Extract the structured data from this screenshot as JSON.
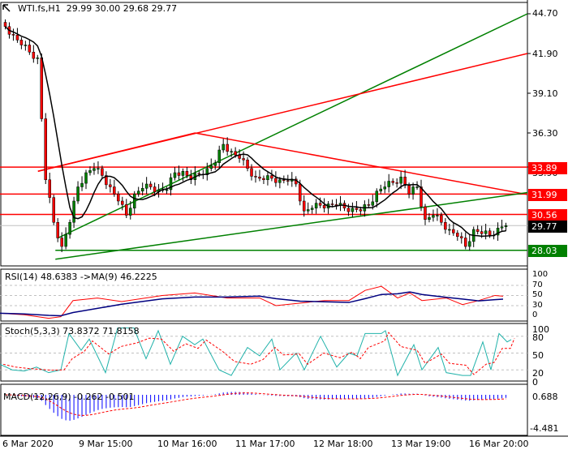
{
  "header": {
    "symbol": "WTI.fs,H1",
    "ohlc": "29.99 30.00 29.68 29.77"
  },
  "price_axis": [
    "44.70",
    "41.90",
    "39.10",
    "36.30",
    "33.90"
  ],
  "price_tags": [
    {
      "label": "33.89",
      "color": "#ff0000"
    },
    {
      "label": "31.99",
      "color": "#ff0000"
    },
    {
      "label": "30.56",
      "color": "#ff0000"
    },
    {
      "label": "29.77",
      "color": "#000000"
    },
    {
      "label": "28.03",
      "color": "#008000"
    }
  ],
  "time_axis": [
    "6 Mar 2020",
    "9 Mar 15:00",
    "10 Mar 16:00",
    "11 Mar 17:00",
    "12 Mar 18:00",
    "13 Mar 19:00",
    "16 Mar 20:00"
  ],
  "rsi": {
    "label": "RSI(14) 48.6383  ->MA(9) 46.2225",
    "axis": [
      "100",
      "70",
      "50",
      "30",
      "0"
    ]
  },
  "stoch": {
    "label": "Stoch(5,3,3) 73.8372 71.8158",
    "axis": [
      "100",
      "80",
      "50",
      "20",
      "0"
    ]
  },
  "macd": {
    "label": "MACD(12,26,9) -0.262 -0.501",
    "axis": [
      "0.688",
      "-4.481"
    ]
  },
  "colors": {
    "up": "#008000",
    "down": "#ff0000",
    "ma": "#000000",
    "rsi": "#ff0000",
    "rsi_ma": "#000080",
    "stoch_k": "#20b2aa",
    "stoch_d": "#ff0000",
    "macd_hist": "#0000ff"
  },
  "chart_data": {
    "type": "candlestick",
    "title": "WTI.fs,H1",
    "ylim": [
      27.3,
      45.6
    ],
    "closes": [
      43.8,
      43.2,
      42.5,
      42.0,
      41.6,
      33.0,
      30.0,
      28.3,
      30.0,
      32.5,
      33.5,
      33.8,
      33.3,
      32.5,
      31.5,
      30.5,
      32.0,
      32.4,
      32.5,
      32.3,
      32.3,
      33.5,
      33.6,
      33.0,
      33.4,
      33.8,
      34.2,
      35.5,
      35.0,
      34.5,
      33.8,
      33.2,
      33.0,
      33.1,
      33.0,
      32.9,
      32.7,
      30.8,
      31.0,
      31.2,
      31.3,
      31.2,
      31.0,
      31.0,
      30.8,
      31.2,
      32.2,
      32.5,
      32.8,
      33.2,
      32.0,
      32.5,
      30.2,
      30.5,
      30.0,
      29.5,
      29.0,
      28.3,
      29.5,
      29.2,
      29.1,
      29.6,
      29.77
    ],
    "horizontal_levels": [
      33.89,
      31.99,
      30.56,
      28.03
    ],
    "trend_lines": [
      {
        "color": "#008000",
        "from": [
          0.11,
          28.9
        ],
        "to": [
          1,
          44.7
        ]
      },
      {
        "color": "#ff0000",
        "from": [
          0.072,
          33.6
        ],
        "to": [
          1,
          41.9
        ]
      },
      {
        "color": "#ff0000",
        "from": [
          0.072,
          33.6
        ],
        "to": [
          0.37,
          36.3
        ]
      },
      {
        "color": "#ff0000",
        "from": [
          0.37,
          36.3
        ],
        "to": [
          1,
          31.96
        ]
      },
      {
        "color": "#008000",
        "from": [
          0.105,
          27.4
        ],
        "to": [
          1,
          32.1
        ]
      },
      {
        "color": "#008000",
        "from": [
          0.105,
          28.03
        ],
        "to": [
          1,
          28.03
        ]
      }
    ],
    "rsi_points": [
      [
        0,
        15
      ],
      [
        30,
        12
      ],
      [
        60,
        5
      ],
      [
        75,
        8
      ],
      [
        90,
        40
      ],
      [
        120,
        45
      ],
      [
        150,
        38
      ],
      [
        200,
        50
      ],
      [
        240,
        55
      ],
      [
        280,
        45
      ],
      [
        320,
        45
      ],
      [
        340,
        30
      ],
      [
        370,
        35
      ],
      [
        400,
        40
      ],
      [
        430,
        40
      ],
      [
        450,
        60
      ],
      [
        470,
        68
      ],
      [
        490,
        45
      ],
      [
        505,
        55
      ],
      [
        520,
        40
      ],
      [
        550,
        45
      ],
      [
        570,
        32
      ],
      [
        590,
        40
      ],
      [
        610,
        50
      ],
      [
        620,
        48.6
      ]
    ],
    "stoch_k": [
      [
        0,
        30
      ],
      [
        15,
        20
      ],
      [
        30,
        18
      ],
      [
        45,
        25
      ],
      [
        60,
        15
      ],
      [
        75,
        20
      ],
      [
        85,
        85
      ],
      [
        100,
        55
      ],
      [
        110,
        75
      ],
      [
        130,
        15
      ],
      [
        145,
        95
      ],
      [
        165,
        95
      ],
      [
        180,
        40
      ],
      [
        195,
        90
      ],
      [
        210,
        30
      ],
      [
        225,
        80
      ],
      [
        240,
        65
      ],
      [
        250,
        75
      ],
      [
        270,
        20
      ],
      [
        285,
        10
      ],
      [
        305,
        60
      ],
      [
        320,
        45
      ],
      [
        335,
        75
      ],
      [
        345,
        20
      ],
      [
        365,
        50
      ],
      [
        375,
        20
      ],
      [
        395,
        80
      ],
      [
        415,
        25
      ],
      [
        430,
        50
      ],
      [
        440,
        45
      ],
      [
        450,
        85
      ],
      [
        470,
        85
      ],
      [
        475,
        90
      ],
      [
        490,
        10
      ],
      [
        510,
        65
      ],
      [
        520,
        20
      ],
      [
        540,
        60
      ],
      [
        550,
        15
      ],
      [
        570,
        10
      ],
      [
        580,
        10
      ],
      [
        595,
        70
      ],
      [
        605,
        20
      ],
      [
        615,
        85
      ],
      [
        625,
        70
      ],
      [
        630,
        74
      ]
    ]
  }
}
